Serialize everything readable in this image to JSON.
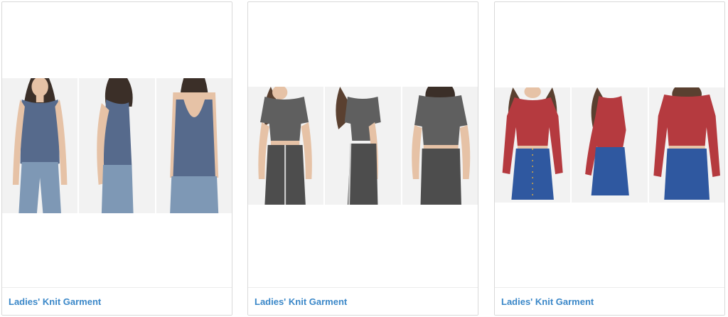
{
  "products": [
    {
      "title": "Ladies' Knit Garment",
      "image_alt": "Blue-grey heathered knit tank top with jeans, shown front, side and back",
      "colors": {
        "top": "#566a8c",
        "bottom": "#7e98b5",
        "backdrop": "#f2f2f2"
      }
    },
    {
      "title": "Ladies' Knit Garment",
      "image_alt": "Charcoal ribbed knit crop top and zip-front skirt set, shown front, side and back",
      "colors": {
        "top": "#5f5f5f",
        "bottom": "#4d4d4d",
        "backdrop": "#f2f2f2"
      }
    },
    {
      "title": "Ladies' Knit Garment",
      "image_alt": "Red long-sleeve knit crop top with denim skirt, shown front, side and back",
      "colors": {
        "top": "#b53a3f",
        "bottom": "#2f58a0",
        "backdrop": "#f2f2f2"
      }
    }
  ]
}
